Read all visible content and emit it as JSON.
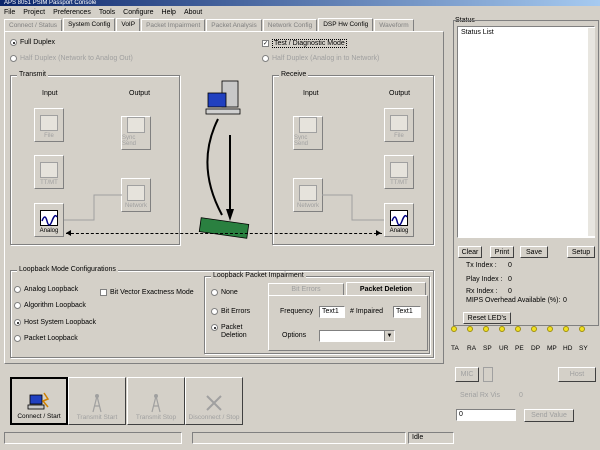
{
  "window": {
    "title": "APS 8051 PSIM Passport Console"
  },
  "menu": [
    "File",
    "Project",
    "Preferences",
    "Tools",
    "Configure",
    "Help",
    "About"
  ],
  "tabs": [
    "Connect / Status",
    "System Config",
    "VoIP",
    "Packet Impairment",
    "Packet Analysis",
    "Network Config",
    "DSP Hw Config",
    "Waveform"
  ],
  "config": {
    "full_duplex": "Full Duplex",
    "half_duplex": "Half Duplex (Network to Analog Out)",
    "test_mode": "Test / Diagnostic Mode",
    "half_duplex_right": "Half Duplex (Analog in to Network)"
  },
  "transmit": {
    "label": "Transmit",
    "input": "Input",
    "output": "Output",
    "file": "File",
    "ttmt": "TT/MT",
    "analog": "Analog",
    "sync_send": "Sync Send",
    "network": "Network"
  },
  "receive": {
    "label": "Receive",
    "input": "Input",
    "output": "Output",
    "sync_send": "Sync Send",
    "network": "Network",
    "file": "File",
    "ttmt": "TT/MT",
    "analog": "Analog"
  },
  "loopback": {
    "label": "Loopback Mode Configurations",
    "analog": "Analog Loopback",
    "algorithm": "Algorithm Loopback",
    "host": "Host System Loopback",
    "packet": "Packet Loopback",
    "bit_vector": "Bit Vector Exactness Mode"
  },
  "impairment": {
    "label": "Loopback Packet Impairment",
    "none": "None",
    "bit_errors_opt": "Bit Errors",
    "packet_deletion_opt": "Packet Deletion",
    "tab_bit_errors": "Bit Errors",
    "tab_packet_deletion": "Packet Deletion",
    "frequency_label": "Frequency",
    "frequency_value": "Text1",
    "impaired_label": "# Impaired",
    "impaired_value": "Text1",
    "options_label": "Options"
  },
  "status": {
    "label": "Status",
    "list_header": "Status List",
    "clear": "Clear",
    "print": "Print",
    "save": "Save",
    "setup": "Setup",
    "tx_index": "Tx Index :",
    "tx_index_value": "0",
    "play_index": "Play Index :",
    "play_index_value": "0",
    "rx_index": "Rx Index :",
    "rx_index_value": "0",
    "mips": "MIPS Overhead Available (%):",
    "mips_value": "0",
    "reset_leds": "Reset LED's"
  },
  "leds": [
    "TA",
    "RA",
    "SP",
    "UR",
    "PE",
    "DP",
    "MP",
    "HD",
    "SY"
  ],
  "lower_right": {
    "mic": "MIC",
    "host": "Host",
    "serial_rx": "Serial Rx Vis",
    "serial_value": "0",
    "input_value": "0",
    "send_button": "Send Value"
  },
  "actions": {
    "connect": "Connect / Start",
    "transmit": "Transmit Start",
    "transmit_stop": "Transmit Stop",
    "disconnect": "Disconnect / Stop"
  },
  "statusbar": {
    "idle": "Idle"
  },
  "colors": {
    "titlebar": "#0a246a",
    "led": "#f0e020",
    "face": "#d4d0c8"
  }
}
